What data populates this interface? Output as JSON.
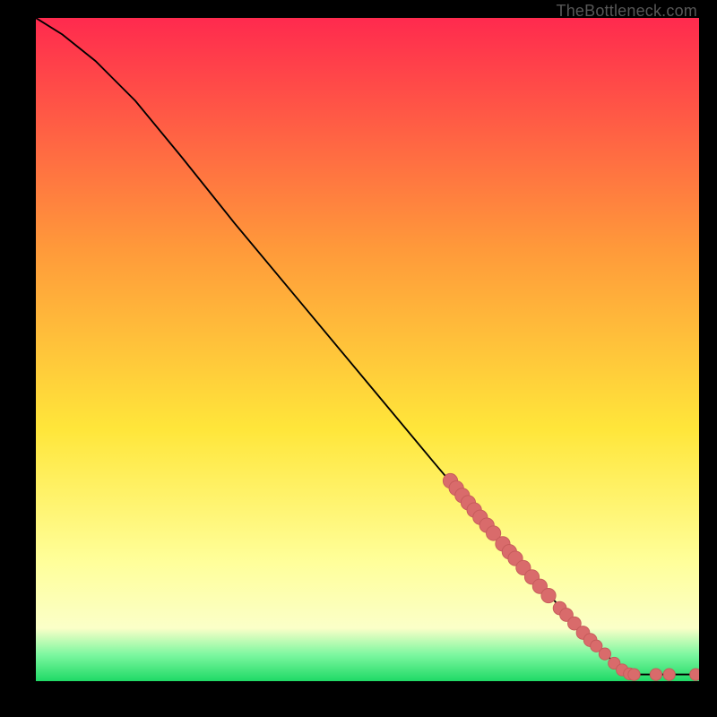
{
  "watermark": "TheBottleneck.com",
  "colors": {
    "point": "#d96b6b",
    "point_stroke": "#c55a5a",
    "line": "#000000",
    "gradient_top": "#ff2a4e",
    "gradient_mid_orange": "#ff9a3a",
    "gradient_yellow": "#ffe63a",
    "gradient_pale_yellow": "#ffff9a",
    "gradient_cream": "#fbffc8",
    "gradient_mint": "#7df7a0",
    "gradient_green": "#1fda66"
  },
  "chart_data": {
    "type": "line",
    "title": "",
    "xlabel": "",
    "ylabel": "",
    "xlim": [
      0,
      100
    ],
    "ylim": [
      0,
      100
    ],
    "curve": [
      {
        "x": 0,
        "y": 100
      },
      {
        "x": 4,
        "y": 97.5
      },
      {
        "x": 9,
        "y": 93.5
      },
      {
        "x": 15,
        "y": 87.5
      },
      {
        "x": 22,
        "y": 79
      },
      {
        "x": 30,
        "y": 69
      },
      {
        "x": 40,
        "y": 57
      },
      {
        "x": 50,
        "y": 45
      },
      {
        "x": 60,
        "y": 33
      },
      {
        "x": 68,
        "y": 23.5
      },
      {
        "x": 76,
        "y": 14.5
      },
      {
        "x": 82,
        "y": 8
      },
      {
        "x": 86,
        "y": 4
      },
      {
        "x": 88.5,
        "y": 1.5
      },
      {
        "x": 90,
        "y": 1.0
      },
      {
        "x": 100,
        "y": 1.0
      }
    ],
    "points": [
      {
        "x": 62.5,
        "y": 30.2,
        "r": 1.1
      },
      {
        "x": 63.4,
        "y": 29.1,
        "r": 1.1
      },
      {
        "x": 64.3,
        "y": 28.0,
        "r": 1.1
      },
      {
        "x": 65.2,
        "y": 26.9,
        "r": 1.1
      },
      {
        "x": 66.1,
        "y": 25.8,
        "r": 1.1
      },
      {
        "x": 67.0,
        "y": 24.7,
        "r": 1.1
      },
      {
        "x": 68.0,
        "y": 23.5,
        "r": 1.1
      },
      {
        "x": 69.0,
        "y": 22.3,
        "r": 1.1
      },
      {
        "x": 70.4,
        "y": 20.7,
        "r": 1.1
      },
      {
        "x": 71.4,
        "y": 19.5,
        "r": 1.1
      },
      {
        "x": 72.3,
        "y": 18.5,
        "r": 1.1
      },
      {
        "x": 73.5,
        "y": 17.1,
        "r": 1.1
      },
      {
        "x": 74.8,
        "y": 15.7,
        "r": 1.1
      },
      {
        "x": 76.0,
        "y": 14.3,
        "r": 1.1
      },
      {
        "x": 77.3,
        "y": 12.9,
        "r": 1.1
      },
      {
        "x": 79.0,
        "y": 11.0,
        "r": 1.0
      },
      {
        "x": 80.0,
        "y": 10.0,
        "r": 1.0
      },
      {
        "x": 81.2,
        "y": 8.7,
        "r": 1.0
      },
      {
        "x": 82.5,
        "y": 7.3,
        "r": 1.0
      },
      {
        "x": 83.6,
        "y": 6.2,
        "r": 1.0
      },
      {
        "x": 84.5,
        "y": 5.3,
        "r": 0.9
      },
      {
        "x": 85.8,
        "y": 4.1,
        "r": 0.9
      },
      {
        "x": 87.2,
        "y": 2.7,
        "r": 0.9
      },
      {
        "x": 88.4,
        "y": 1.7,
        "r": 0.9
      },
      {
        "x": 89.5,
        "y": 1.1,
        "r": 0.9
      },
      {
        "x": 90.2,
        "y": 1.0,
        "r": 0.9
      },
      {
        "x": 93.5,
        "y": 1.0,
        "r": 0.9
      },
      {
        "x": 95.5,
        "y": 1.0,
        "r": 0.9
      },
      {
        "x": 99.5,
        "y": 1.0,
        "r": 0.9
      }
    ]
  }
}
